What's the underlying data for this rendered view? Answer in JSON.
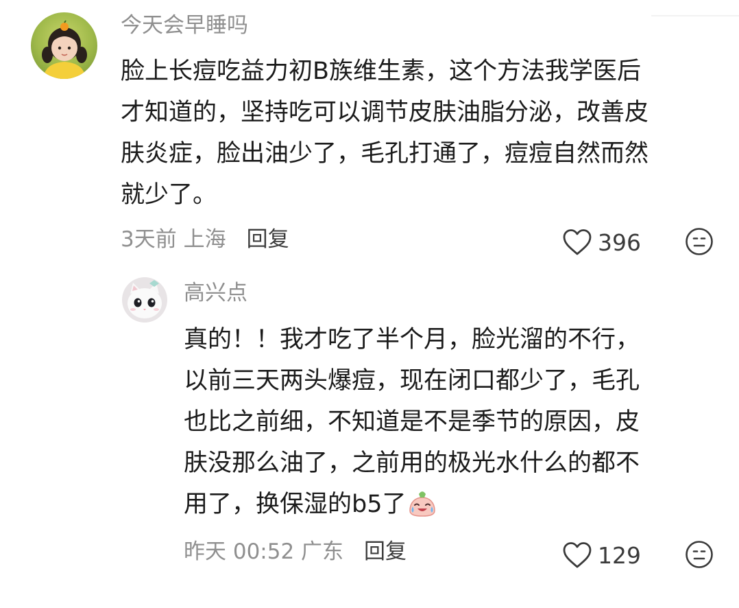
{
  "main_comment": {
    "username": "今天会早睡吗",
    "text_lines": [
      "脸上长痘吃益力初B族维生素，这个方法我学医后",
      "才知道的，坚持吃可以调节皮肤油脂分泌，改善皮",
      "肤炎症，脸出油少了，毛孔打通了，痘痘自然而然",
      "就少了。"
    ],
    "time_location": "3天前 上海",
    "reply_label": "回复",
    "like_count": "396",
    "avatar_icon": "girl-avatar",
    "like_icon": "heart-outline-icon",
    "dislike_icon": "unhappy-face-icon"
  },
  "reply_comment": {
    "username": "高兴点",
    "text_lines": [
      "真的！！我才吃了半个月，脸光溜的不行，",
      "以前三天两头爆痘，现在闭口都少了，毛孔",
      "也比之前细，不知道是不是季节的原因，皮",
      "肤没那么油了，之前用的极光水什么的都不",
      "用了，换保湿的b5了"
    ],
    "emoji": "crying-laughing-face-emoji",
    "time_location": "昨天 00:52 广东",
    "reply_label": "回复",
    "like_count": "129",
    "avatar_icon": "white-cat-avatar",
    "like_icon": "heart-outline-icon",
    "dislike_icon": "unhappy-face-icon"
  },
  "colors": {
    "username": "#8f8f8f",
    "body_text": "#1b1b1b",
    "meta": "#8f8f8f",
    "reply_button": "#3d3d3d",
    "icon": "#3a3a3a"
  }
}
